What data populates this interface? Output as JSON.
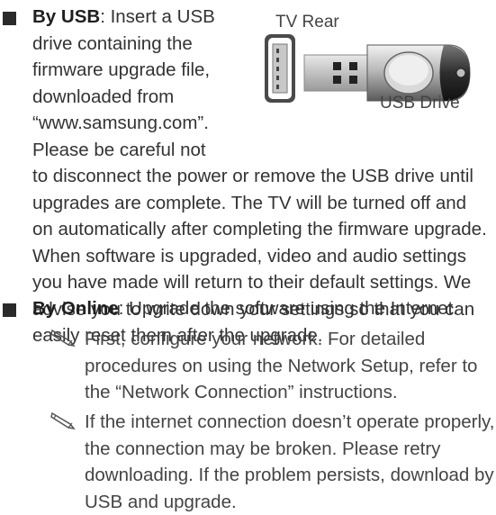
{
  "usb": {
    "heading": "By USB",
    "intro_lines": [
      ": Insert a USB",
      "drive containing the",
      "firmware upgrade file,",
      "downloaded from",
      "“www.samsung.com”.",
      "Please be careful not"
    ],
    "body_lines": [
      "to disconnect the power or remove the USB drive until",
      "upgrades are complete. The TV will be turned off and",
      "on automatically after completing the firmware upgrade.",
      "When software is upgraded, video and audio settings",
      "you have made will return to their default settings. We",
      "advise you to write down your settings so that you can",
      "easily reset them after the upgrade."
    ],
    "figure": {
      "tv_label": "TV Rear",
      "drive_label": "USB Drive"
    }
  },
  "online": {
    "heading": "By Online",
    "text": ": Upgrade the software using the Internet.",
    "notes": [
      {
        "icon": "pencil-note-icon",
        "lines": [
          "First, configure your network. For detailed",
          "procedures on using the Network Setup, refer to",
          "the “Network Connection” instructions."
        ]
      },
      {
        "icon": "pencil-note-icon",
        "lines": [
          "If the internet connection doesn’t operate properly,",
          "the connection may be broken. Please retry",
          "downloading. If the problem persists, download by",
          "USB and upgrade."
        ]
      }
    ]
  }
}
